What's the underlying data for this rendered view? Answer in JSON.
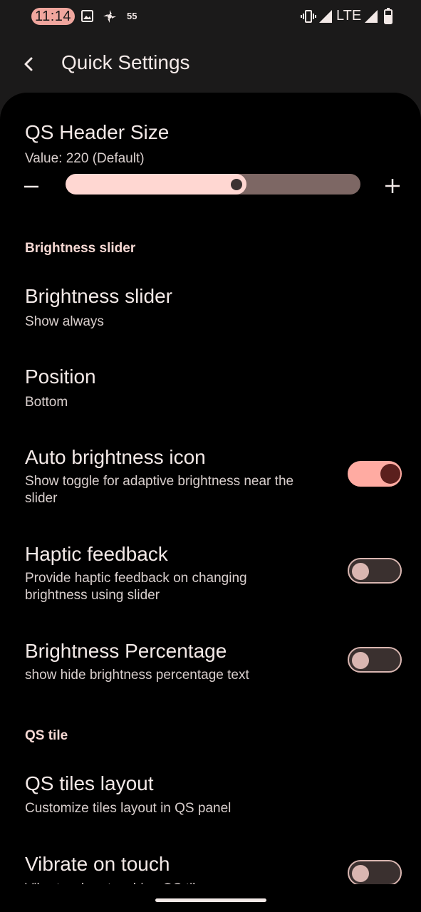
{
  "status_bar": {
    "time": "11:14",
    "notification_count": "55",
    "network": "LTE"
  },
  "app_bar": {
    "title": "Quick Settings"
  },
  "qs_header": {
    "title": "QS Header Size",
    "value_text": "Value: 220 (Default)",
    "level_fraction": 0.58
  },
  "sections": {
    "brightness": "Brightness slider",
    "qs_tile": "QS tile"
  },
  "prefs": {
    "brightness_slider": {
      "title": "Brightness slider",
      "summary": "Show always"
    },
    "position": {
      "title": "Position",
      "summary": "Bottom"
    },
    "auto_brightness": {
      "title": "Auto brightness icon",
      "summary": "Show toggle for adaptive brightness near the slider",
      "checked": true
    },
    "haptic": {
      "title": "Haptic feedback",
      "summary": "Provide haptic feedback on changing brightness using slider",
      "checked": false
    },
    "percentage": {
      "title": "Brightness Percentage",
      "summary": "show hide brightness percentage text",
      "checked": false
    },
    "tiles_layout": {
      "title": "QS tiles layout",
      "summary": "Customize tiles layout in QS panel"
    },
    "vibrate": {
      "title": "Vibrate on touch",
      "summary": "Vibrate when touching QS tiles",
      "checked": false
    }
  },
  "colors": {
    "accent": "#ffaba2",
    "background": "#000000",
    "toolbar": "#1b1a1a"
  },
  "icons": {
    "back": "chevron-left-icon",
    "minus": "minus-icon",
    "plus": "plus-icon"
  }
}
